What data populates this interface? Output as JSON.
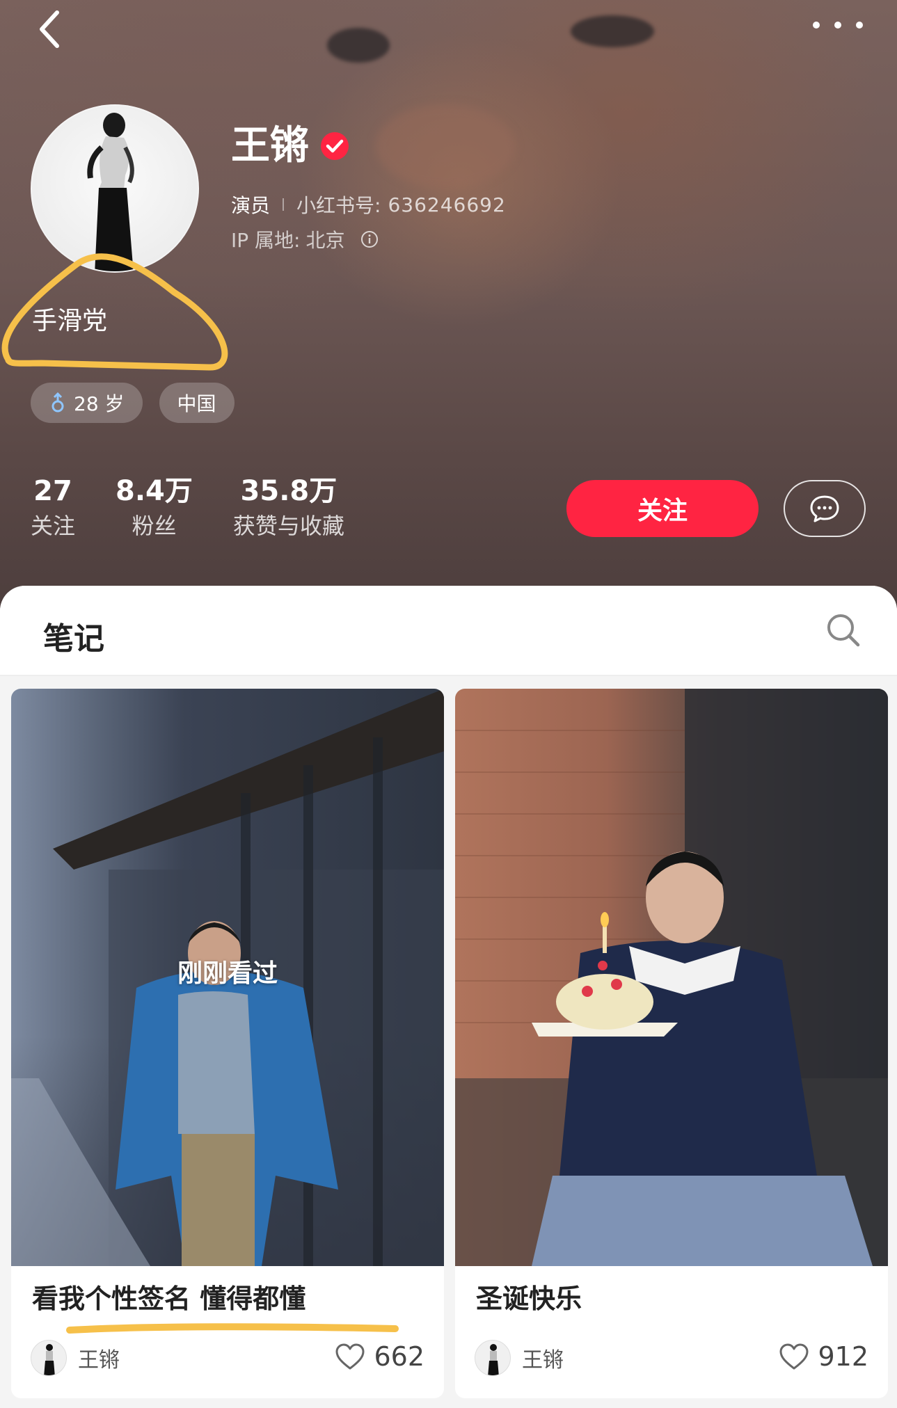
{
  "profile": {
    "name": "王锵",
    "role": "演员",
    "redid_label": "小红书号:",
    "redid_value": "636246692",
    "ip_label": "IP 属地:",
    "ip_value": "北京",
    "bio": "手滑党",
    "tags": {
      "age": "28 岁",
      "region": "中国"
    }
  },
  "stats": [
    {
      "num": "27",
      "label": "关注"
    },
    {
      "num": "8.4万",
      "label": "粉丝"
    },
    {
      "num": "35.8万",
      "label": "获赞与收藏"
    }
  ],
  "actions": {
    "follow_label": "关注"
  },
  "notes": {
    "tab_label": "笔记",
    "cards": [
      {
        "badge": "刚刚看过",
        "title": "看我个性签名 懂得都懂",
        "author": "王锵",
        "likes": "662"
      },
      {
        "badge": "",
        "title": "圣诞快乐",
        "author": "王锵",
        "likes": "912"
      }
    ]
  },
  "colors": {
    "accent": "#ff2442",
    "highlight": "#f6c04a"
  }
}
